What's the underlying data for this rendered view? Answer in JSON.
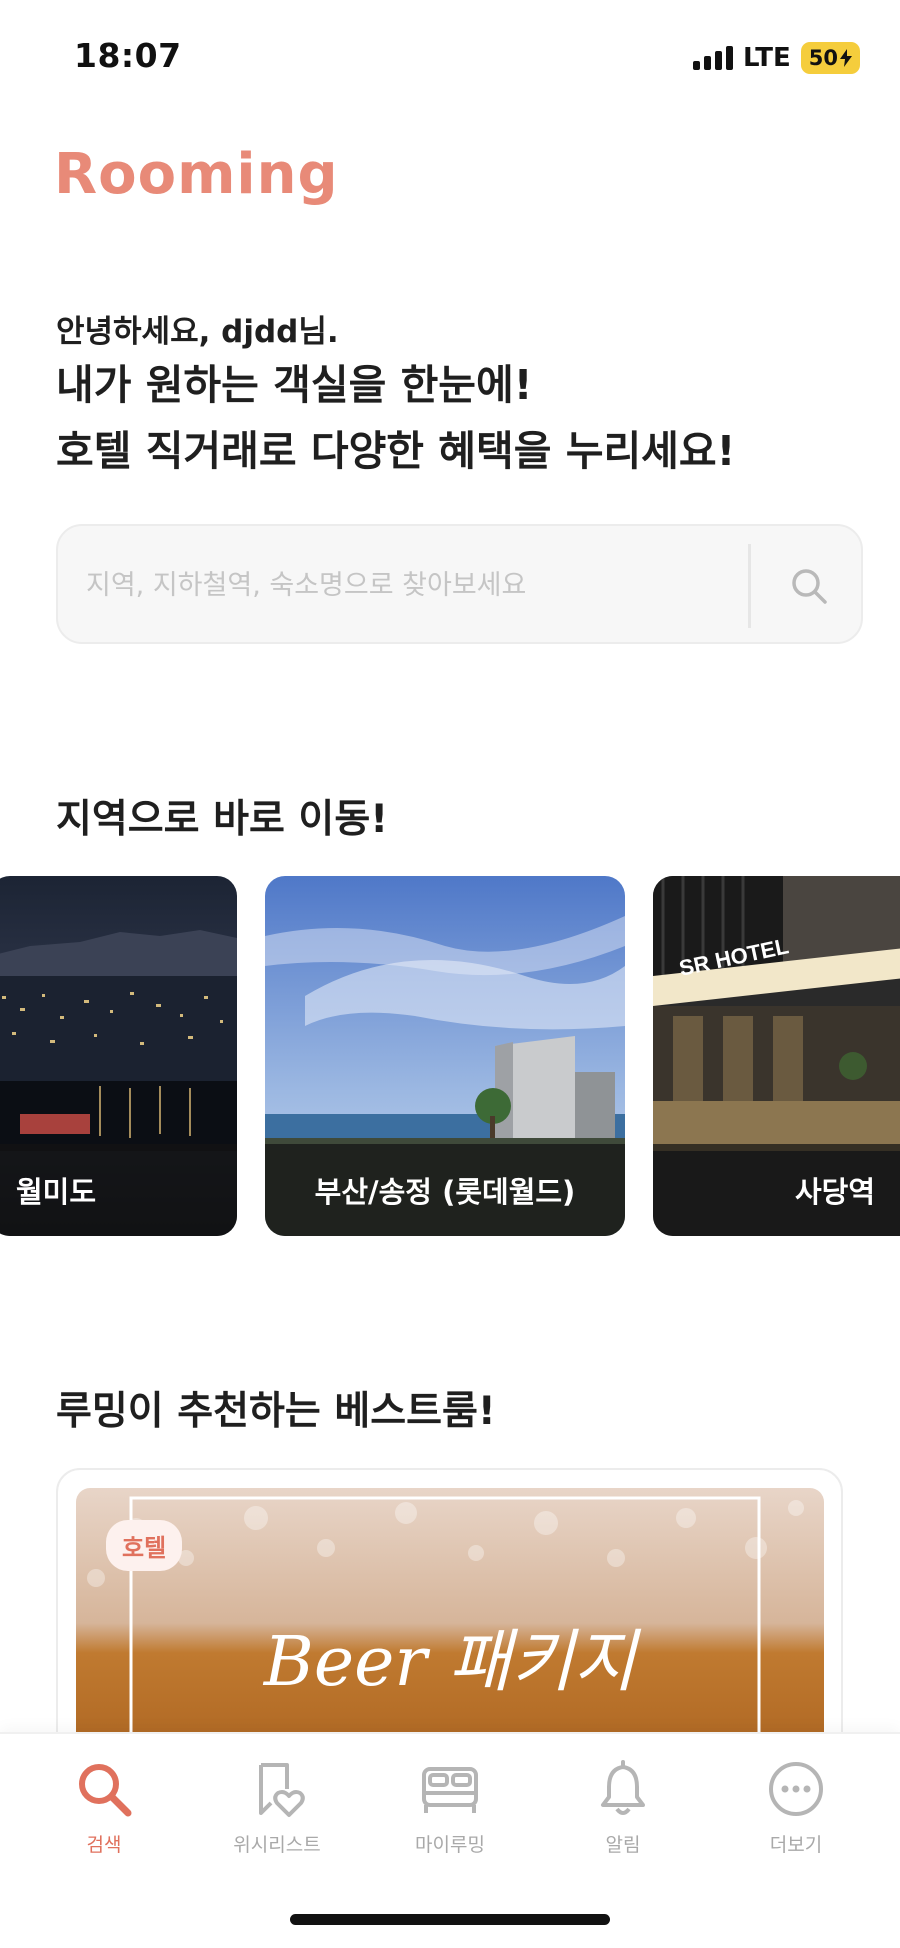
{
  "status_bar": {
    "time": "18:07",
    "network": "LTE",
    "battery": "50"
  },
  "brand": {
    "logo_text": "Rooming",
    "accent_color": "#e88a78"
  },
  "greeting": {
    "hello": "안녕하세요, djdd님.",
    "headline_line1": "내가 원하는 객실을 한눈에!",
    "headline_line2": "호텔 직거래로 다양한 혜택을 누리세요!"
  },
  "search": {
    "placeholder": "지역, 지하철역, 숙소명으로 찾아보세요",
    "value": ""
  },
  "regions": {
    "title": "지역으로 바로 이동!",
    "items": [
      {
        "label": "월미도",
        "icon": "night-city-photo"
      },
      {
        "label": "부산/송정 (롯데월드)",
        "icon": "seaside-building-photo"
      },
      {
        "label": "사당역",
        "icon": "hotel-entrance-photo"
      }
    ]
  },
  "best_rooms": {
    "title": "루밍이 추천하는 베스트룸!",
    "items": [
      {
        "badge": "호텔",
        "image_text": "Beer 패키지"
      }
    ]
  },
  "tab_bar": {
    "items": [
      {
        "label": "검색",
        "icon": "search-icon",
        "active": true
      },
      {
        "label": "위시리스트",
        "icon": "wishlist-icon",
        "active": false
      },
      {
        "label": "마이루밍",
        "icon": "bed-icon",
        "active": false
      },
      {
        "label": "알림",
        "icon": "bell-icon",
        "active": false
      },
      {
        "label": "더보기",
        "icon": "more-icon",
        "active": false
      }
    ]
  }
}
